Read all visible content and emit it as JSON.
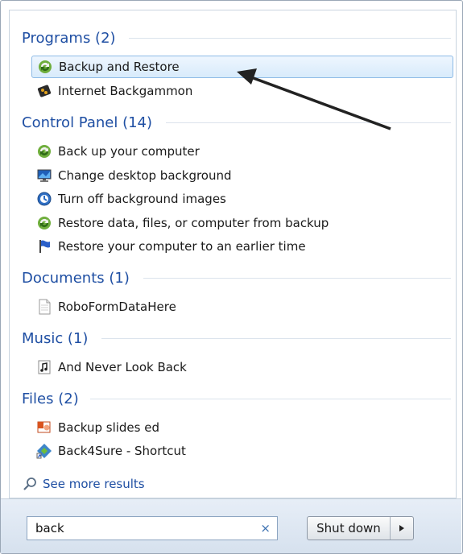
{
  "categories": {
    "programs": "Programs (2)",
    "control_panel": "Control Panel (14)",
    "documents": "Documents (1)",
    "music": "Music (1)",
    "files": "Files (2)"
  },
  "programs": [
    {
      "label": "Backup and Restore",
      "icon": "backup-restore-icon"
    },
    {
      "label": "Internet Backgammon",
      "icon": "backgammon-icon"
    }
  ],
  "control_panel": [
    {
      "label": "Back up your computer",
      "icon": "backup-restore-icon"
    },
    {
      "label": "Change desktop background",
      "icon": "monitor-icon"
    },
    {
      "label": "Turn off background images",
      "icon": "ease-of-access-icon"
    },
    {
      "label": "Restore data, files, or computer from backup",
      "icon": "backup-restore-icon"
    },
    {
      "label": "Restore your computer to an earlier time",
      "icon": "flag-icon"
    }
  ],
  "documents": [
    {
      "label": "RoboFormDataHere",
      "icon": "document-icon"
    }
  ],
  "music": [
    {
      "label": "And Never Look Back",
      "icon": "music-file-icon"
    }
  ],
  "files": [
    {
      "label": "Backup slides ed",
      "icon": "presentation-icon"
    },
    {
      "label": "Back4Sure - Shortcut",
      "icon": "shortcut-icon"
    }
  ],
  "see_more": "See more results",
  "search": {
    "value": "back",
    "clear": "×"
  },
  "shutdown": {
    "label": "Shut down"
  }
}
